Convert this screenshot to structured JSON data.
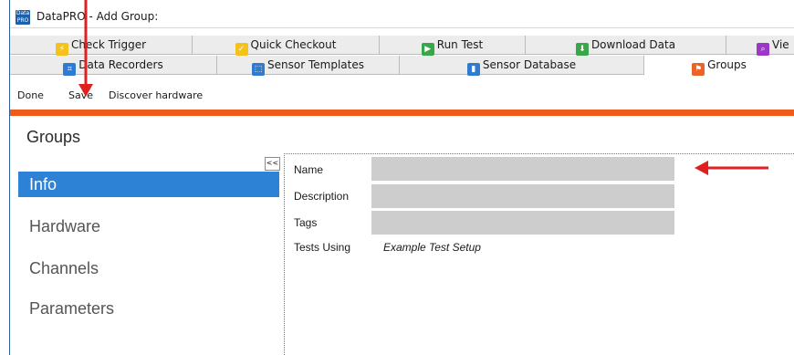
{
  "window": {
    "title": "DataPRO - Add Group:",
    "icon": "datapro-app-icon"
  },
  "tabs_row1": [
    {
      "label": "Check Trigger",
      "icon": "trigger-icon",
      "color": "#f4c21b"
    },
    {
      "label": "Quick Checkout",
      "icon": "checkout-icon",
      "color": "#f4c21b"
    },
    {
      "label": "Run Test",
      "icon": "run-test-icon",
      "color": "#3aa64a"
    },
    {
      "label": "Download Data",
      "icon": "download-icon",
      "color": "#3aa64a"
    },
    {
      "label": "Vie",
      "icon": "view-icon",
      "color": "#9b37c9"
    }
  ],
  "tabs_row2": [
    {
      "label": "Data Recorders",
      "icon": "recorder-icon",
      "color": "#2e7bd1"
    },
    {
      "label": "Sensor Templates",
      "icon": "template-icon",
      "color": "#2e7bd1"
    },
    {
      "label": "Sensor Database",
      "icon": "database-icon",
      "color": "#2e7bd1"
    },
    {
      "label": "Groups",
      "icon": "groups-icon",
      "color": "#e8642a",
      "active": true
    }
  ],
  "toolbar": {
    "done": "Done",
    "save": "Save",
    "discover": "Discover hardware"
  },
  "accent_color": "#f05a1a",
  "page_title": "Groups",
  "collapse_label": "<<",
  "nav": [
    {
      "label": "Info",
      "active": true
    },
    {
      "label": "Hardware"
    },
    {
      "label": "Channels"
    },
    {
      "label": "Parameters"
    }
  ],
  "form": {
    "name_label": "Name",
    "name_value": "",
    "description_label": "Description",
    "description_value": "",
    "tags_label": "Tags",
    "tags_value": "",
    "tests_using_label": "Tests Using",
    "tests_using_value": "Example Test Setup"
  },
  "annotations": {
    "arrow_color": "#e02020"
  }
}
